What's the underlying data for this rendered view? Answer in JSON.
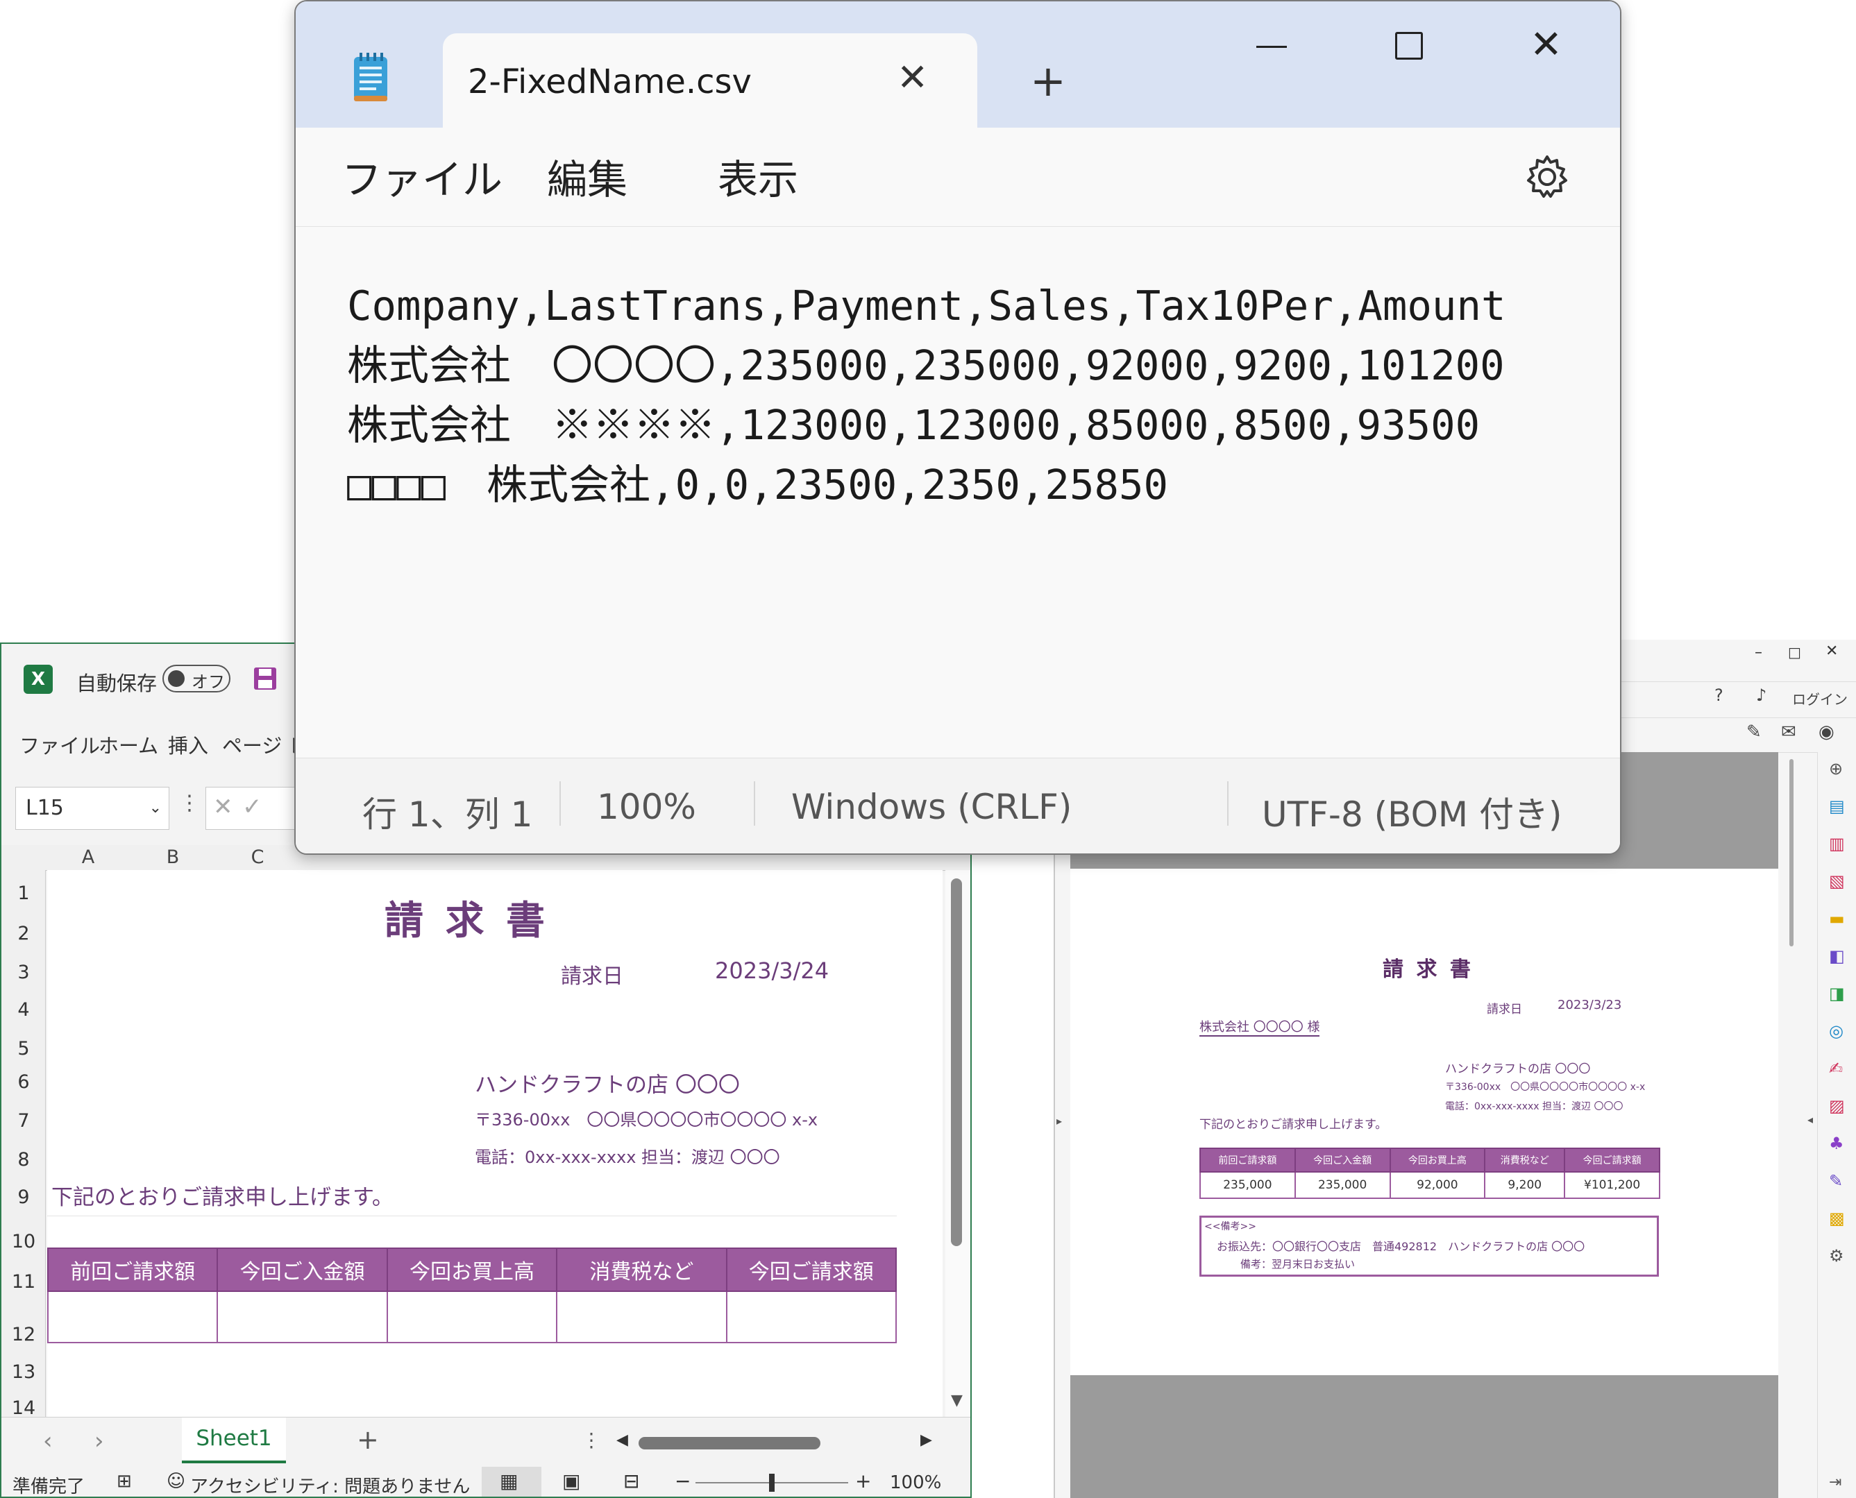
{
  "excel": {
    "autosave_label": "自動保存",
    "autosave_state": "オフ",
    "menu": [
      "ファイル",
      "ホーム",
      "挿入",
      "ページ レ"
    ],
    "name_box": "L15",
    "columns": [
      "A",
      "B",
      "C"
    ],
    "rows": [
      "1",
      "2",
      "3",
      "4",
      "5",
      "6",
      "7",
      "8",
      "9",
      "10",
      "11",
      "12",
      "13",
      "14"
    ],
    "invoice": {
      "title": "請 求 書",
      "date_label": "請求日",
      "date_value": "2023/3/24",
      "shop_name": "ハンドクラフトの店 〇〇〇",
      "shop_address": "〒336-00xx　〇〇県〇〇〇〇市〇〇〇〇 x-x",
      "shop_phone": "電話：0xx-xxx-xxxx 担当：渡辺 〇〇〇",
      "intro": "下記のとおりご請求申し上げます。",
      "table_headers": [
        "前回ご請求額",
        "今回ご入金額",
        "今回お買上高",
        "消費税など",
        "今回ご請求額"
      ]
    },
    "sheet_tab": "Sheet1",
    "status_ready": "準備完了",
    "status_accessibility": "アクセシビリティ: 問題ありません",
    "zoom": "100%",
    "colors": {
      "frame": "#2e7d4f",
      "table_header": "#9c5b9e",
      "text_purple": "#6b3d7a"
    }
  },
  "pdf": {
    "login": "ログイン",
    "page": {
      "title": "請 求 書",
      "date_label": "請求日",
      "date_value": "2023/3/23",
      "recipient": "株式会社 〇〇〇〇 様",
      "shop_name": "ハンドクラフトの店 〇〇〇",
      "shop_address": "〒336-00xx　〇〇県〇〇〇〇市〇〇〇〇 x-x",
      "shop_phone": "電話：0xx-xxx-xxxx 担当：渡辺 〇〇〇",
      "intro": "下記のとおりご請求申し上げます。",
      "table_headers": [
        "前回ご請求額",
        "今回ご入金額",
        "今回お買上高",
        "消費税など",
        "今回ご請求額"
      ],
      "table_values": [
        "235,000",
        "235,000",
        "92,000",
        "9,200",
        "¥101,200"
      ],
      "remarks_title": "<<備考>>",
      "remarks_line1": "お振込先：〇〇銀行〇〇支店　普通492812　ハンドクラフトの店 〇〇〇",
      "remarks_line2": "備考：翌月末日お支払い"
    }
  },
  "notepad": {
    "tab_title": "2-FixedName.csv",
    "menu": [
      "ファイル",
      "編集",
      "表示"
    ],
    "content": "Company,LastTrans,Payment,Sales,Tax10Per,Amount\n株式会社　〇〇〇〇,235000,235000,92000,9200,101200\n株式会社　※※※※,123000,123000,85000,8500,93500\n□□□□　株式会社,0,0,23500,2350,25850",
    "status": {
      "position": "行 1、列 1",
      "zoom": "100%",
      "line_ending": "Windows (CRLF)",
      "encoding": "UTF-8 (BOM 付き)"
    },
    "colors": {
      "tabstrip": "#d9e2f3",
      "editor": "#f9f9f9"
    }
  }
}
